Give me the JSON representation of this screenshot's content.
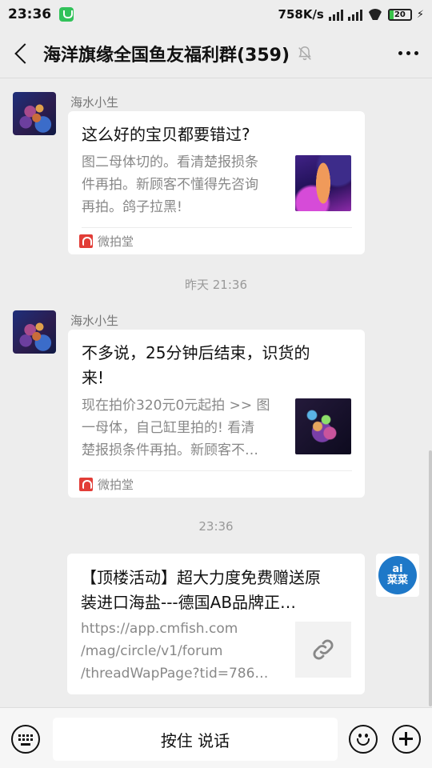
{
  "status": {
    "time": "23:36",
    "net_speed": "758K/s",
    "battery": "20"
  },
  "header": {
    "title": "海洋旗缘全国鱼友福利群(359)"
  },
  "messages": [
    {
      "sender": "海水小生",
      "title": "这么好的宝贝都要错过?",
      "desc_lines": [
        "图二母体切的。看清楚报损条",
        "件再拍。新顾客不懂得先咨询",
        "再拍。鸽子拉黑!"
      ],
      "source": "微拍堂"
    },
    {
      "sender": "海水小生",
      "title_lines": [
        "不多说，25分钟后结束，识货的",
        "来!"
      ],
      "desc_lines": [
        "现在拍价320元0元起拍 >> 图",
        "一母体，自己缸里拍的! 看清",
        "楚报损条件再拍。新顾客不…"
      ],
      "source": "微拍堂"
    },
    {
      "title_lines": [
        "【顶楼活动】超大力度免费赠送原",
        "装进口海盐---德国AB品牌正…"
      ],
      "url_lines": [
        "https://app.cmfish.com",
        "/mag/circle/v1/forum",
        "/threadWapPage?tid=786…"
      ],
      "avatar_text": [
        "ai",
        "菜菜"
      ]
    }
  ],
  "timestamps": [
    "昨天 21:36",
    "23:36"
  ],
  "bottom": {
    "talk_label": "按住 说话"
  }
}
